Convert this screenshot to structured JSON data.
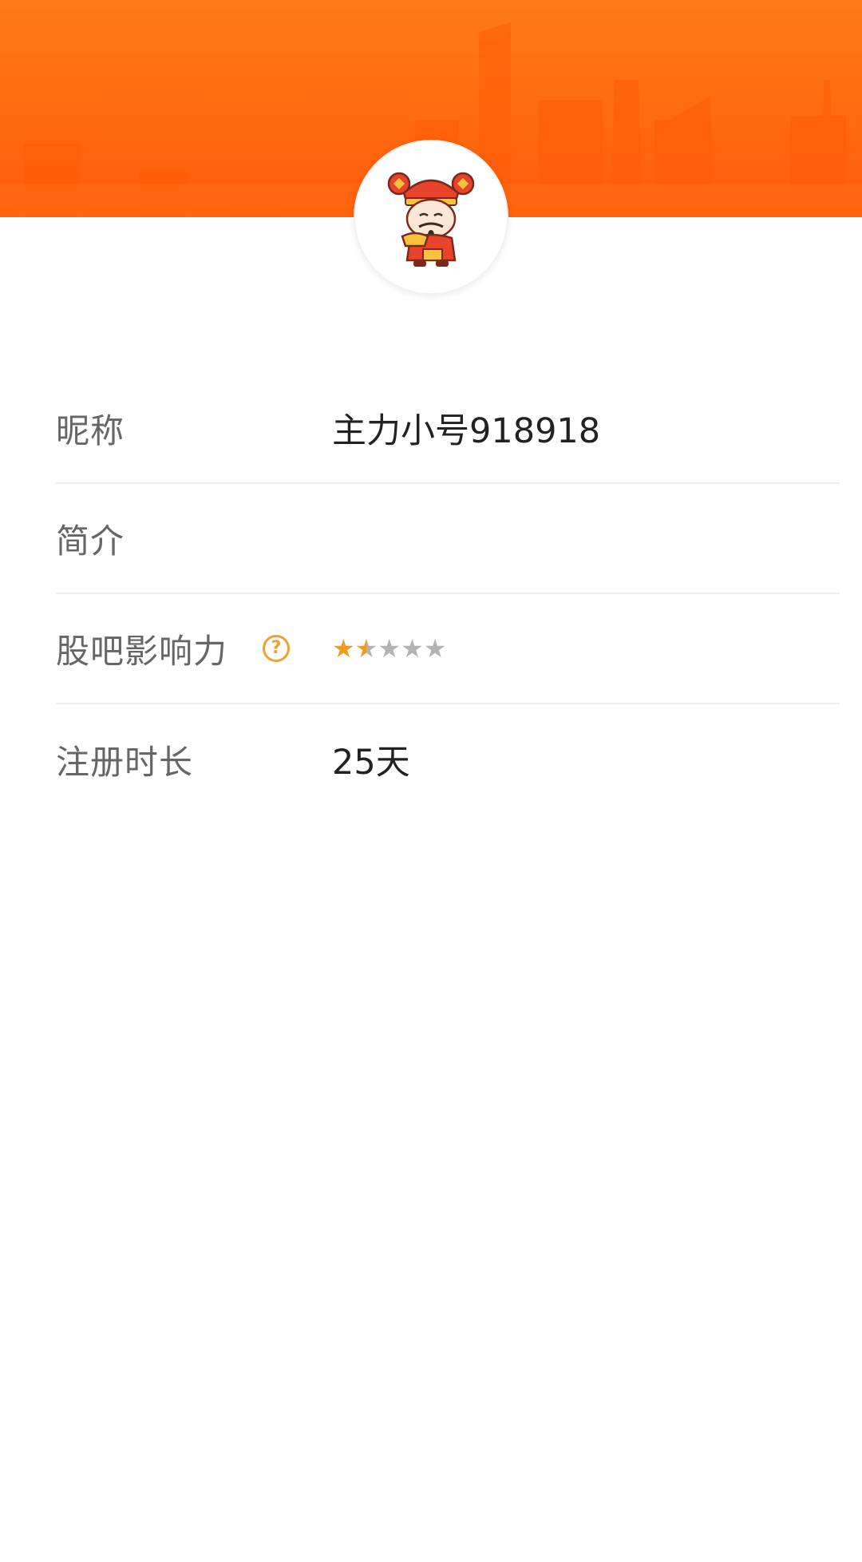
{
  "profile": {
    "avatar_icon": "caishen-avatar-icon",
    "rows": [
      {
        "label": "昵称",
        "value": "主力小号918918"
      },
      {
        "label": "简介",
        "value": ""
      },
      {
        "label": "股吧影响力",
        "help_icon": "question-circle-icon",
        "rating": 1.5,
        "rating_max": 5
      },
      {
        "label": "注册时长",
        "value": "25天"
      }
    ]
  },
  "colors": {
    "banner": "#ff6a10",
    "star_filled": "#f39a1f",
    "star_empty": "#b3b3b3",
    "help_icon": "#f0a030"
  }
}
